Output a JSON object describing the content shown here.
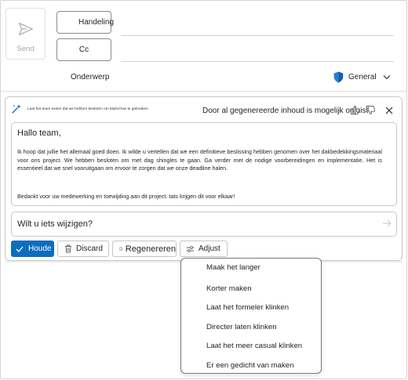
{
  "compose": {
    "send_label": "Send",
    "to_label": "Handeling",
    "cc_label": "Cc",
    "subject_label": "Onderwerp",
    "sensitivity_label": "General",
    "to_value": "",
    "cc_value": ""
  },
  "copilot": {
    "prompt": "Laat het team weten dat we hebben besloten om klatschuw te gebruiken",
    "generated_note": "Door al gegenereerde inhoud is mogelijk onjuist",
    "draft": {
      "greeting": "Hallo team,",
      "paragraph1": "Ik hoop dat jullie het allemaal goed doen. Ik wilde u vertellen dat we een definitieve beslissing hebben genomen over het dakbedekkingsmateriaal voor ons project. We hebben besloten om met dag shingles te gaan. Ga verder met de nodige voorbereidingen en implementatie. Het is essentieel dat we snel vooruitgaan om ervoor te zorgen dat we onze deadline halen.",
      "paragraph2": "Bedankt voor uw medewerking en toewijding aan dit project. tats krijgen dit voor elkaar!"
    },
    "change_placeholder": "Wilt u iets wijzigen?",
    "buttons": {
      "keep": "Houde",
      "discard": "Discard",
      "regenerate": "Regenereren",
      "adjust": "Adjust"
    },
    "adjust_menu": [
      "Maak het langer",
      "Korter maken",
      "Laat het formeler klinken",
      "Directer laten klinken",
      "Laat het meer casual klinken",
      "Er een gedicht van maken"
    ]
  },
  "colors": {
    "accent": "#0f6cbd",
    "shield": "#0f5fb0"
  },
  "icons": [
    "send-icon",
    "shield-icon",
    "chevron-down-icon",
    "copilot-sparkle-icon",
    "thumbs-up-icon",
    "thumbs-down-icon",
    "close-icon",
    "submit-arrow-icon",
    "checkmark-icon",
    "trash-icon",
    "regenerate-icon",
    "adjust-icon"
  ]
}
